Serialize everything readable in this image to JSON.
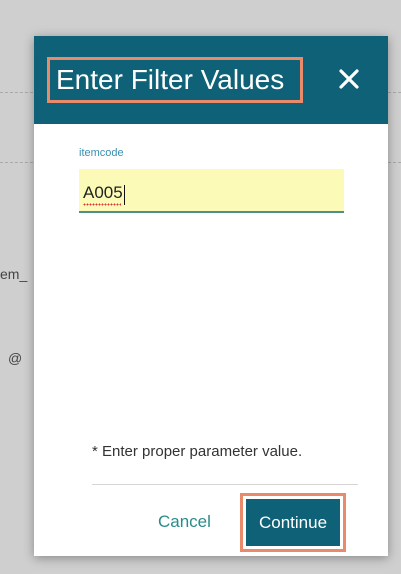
{
  "background": {
    "partial_text_1": "em_",
    "partial_text_2": "@"
  },
  "dialog": {
    "title": "Enter Filter Values",
    "close_icon": "close-icon",
    "field": {
      "label": "itemcode",
      "value": "A005"
    },
    "hint": "* Enter proper parameter value.",
    "cancel_label": "Cancel",
    "continue_label": "Continue"
  },
  "colors": {
    "header": "#0f6177",
    "highlight": "#e98a6a",
    "input_bg": "#fbfbb7",
    "cancel_text": "#2a8b8b"
  }
}
